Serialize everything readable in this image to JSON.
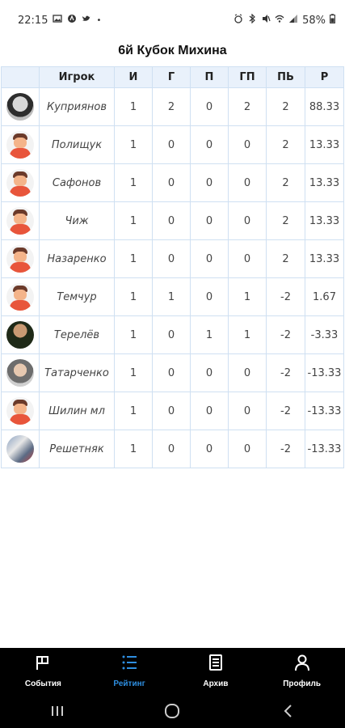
{
  "status_bar": {
    "time": "22:15",
    "battery": "58%",
    "left_icons": [
      "image-icon",
      "app-icon",
      "twitter-icon",
      "dot-icon"
    ],
    "right_icons": [
      "alarm-icon",
      "bluetooth-icon",
      "mute-icon",
      "wifi-icon",
      "signal-icon",
      "battery-icon"
    ]
  },
  "page": {
    "title": "6й Кубок Михина"
  },
  "table": {
    "headers": [
      "",
      "Игрок",
      "И",
      "Г",
      "П",
      "ГП",
      "ПЬ",
      "Р"
    ],
    "rows": [
      {
        "avatar": "photo1",
        "name": "Куприянов",
        "i": "1",
        "g": "2",
        "p": "0",
        "gp": "2",
        "pb": "2",
        "r": "88.33"
      },
      {
        "avatar": "default",
        "name": "Полищук",
        "i": "1",
        "g": "0",
        "p": "0",
        "gp": "0",
        "pb": "2",
        "r": "13.33"
      },
      {
        "avatar": "default",
        "name": "Сафонов",
        "i": "1",
        "g": "0",
        "p": "0",
        "gp": "0",
        "pb": "2",
        "r": "13.33"
      },
      {
        "avatar": "default",
        "name": "Чиж",
        "i": "1",
        "g": "0",
        "p": "0",
        "gp": "0",
        "pb": "2",
        "r": "13.33"
      },
      {
        "avatar": "default",
        "name": "Назаренко",
        "i": "1",
        "g": "0",
        "p": "0",
        "gp": "0",
        "pb": "2",
        "r": "13.33"
      },
      {
        "avatar": "default",
        "name": "Темчур",
        "i": "1",
        "g": "1",
        "p": "0",
        "gp": "1",
        "pb": "-2",
        "r": "1.67"
      },
      {
        "avatar": "photo2",
        "name": "Терелёв",
        "i": "1",
        "g": "0",
        "p": "1",
        "gp": "1",
        "pb": "-2",
        "r": "-3.33"
      },
      {
        "avatar": "photo3",
        "name": "Татарченко",
        "i": "1",
        "g": "0",
        "p": "0",
        "gp": "0",
        "pb": "-2",
        "r": "-13.33"
      },
      {
        "avatar": "default",
        "name": "Шилин мл",
        "i": "1",
        "g": "0",
        "p": "0",
        "gp": "0",
        "pb": "-2",
        "r": "-13.33"
      },
      {
        "avatar": "photo4",
        "name": "Решетняк",
        "i": "1",
        "g": "0",
        "p": "0",
        "gp": "0",
        "pb": "-2",
        "r": "-13.33"
      }
    ]
  },
  "bottom_nav": {
    "items": [
      {
        "label": "События",
        "icon": "flag-icon",
        "active": false
      },
      {
        "label": "Рейтинг",
        "icon": "list-icon",
        "active": true
      },
      {
        "label": "Архив",
        "icon": "archive-icon",
        "active": false
      },
      {
        "label": "Профиль",
        "icon": "person-icon",
        "active": false
      }
    ],
    "active_color": "#2e8ee0"
  },
  "system_nav": [
    "recents-icon",
    "home-icon",
    "back-icon"
  ]
}
